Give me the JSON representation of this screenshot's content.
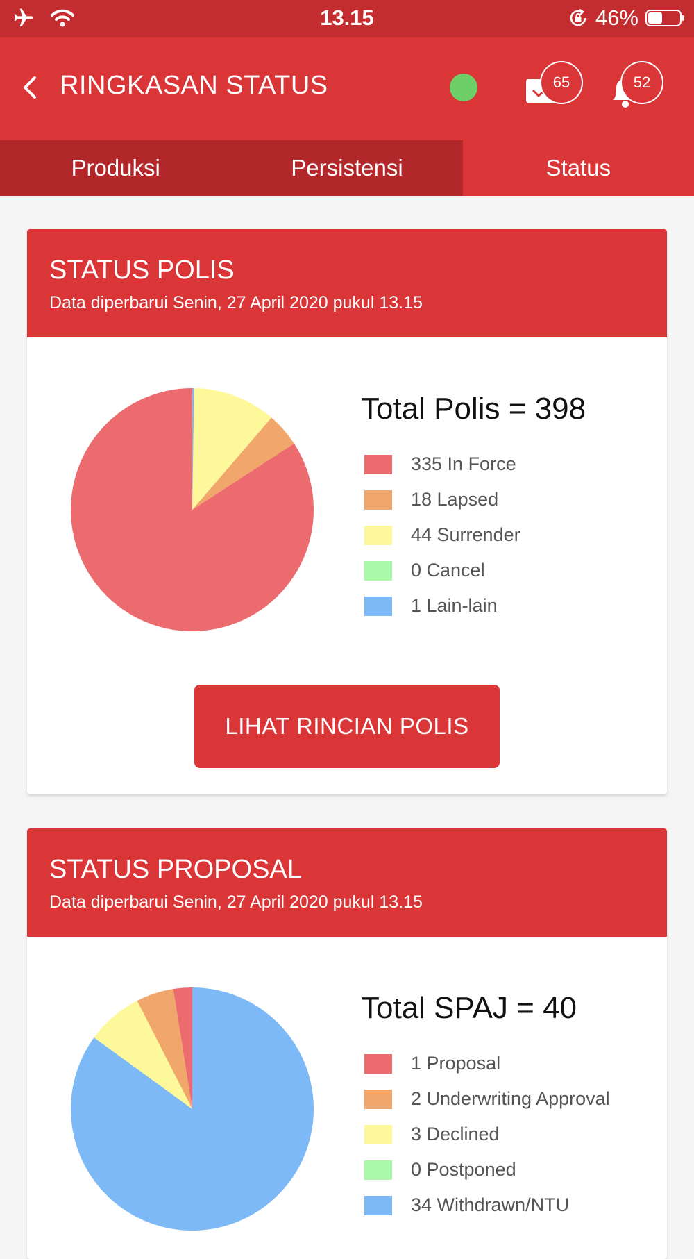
{
  "status_bar": {
    "time": "13.15",
    "battery_percent": "46%",
    "battery_level": 0.46,
    "icons": [
      "airplane-icon",
      "wifi-icon",
      "rotation-lock-icon",
      "battery-icon"
    ]
  },
  "header": {
    "title": "RINGKASAN STATUS",
    "online_color": "#6ecf68",
    "mail_badge": "65",
    "notification_badge": "52"
  },
  "tabs": [
    {
      "label": "Produksi",
      "active": false
    },
    {
      "label": "Persistensi",
      "active": false
    },
    {
      "label": "Status",
      "active": true
    }
  ],
  "colors": {
    "primary": "#da3638",
    "status_bar": "#c42d30",
    "tab_bar": "#b2272a"
  },
  "polis": {
    "title": "STATUS POLIS",
    "updated": "Data diperbarui Senin, 27 April 2020 pukul 13.15",
    "total_label": "Total Polis = 398",
    "button_label": "LIHAT RINCIAN POLIS",
    "legend": [
      {
        "label": "335 In Force",
        "value": 335,
        "color": "#ec6b6f"
      },
      {
        "label": "18 Lapsed",
        "value": 18,
        "color": "#f1a66b"
      },
      {
        "label": "44 Surrender",
        "value": 44,
        "color": "#fdf99b"
      },
      {
        "label": "0 Cancel",
        "value": 0,
        "color": "#aaf9a8"
      },
      {
        "label": "1 Lain-lain",
        "value": 1,
        "color": "#7db9f6"
      }
    ]
  },
  "proposal": {
    "title": "STATUS PROPOSAL",
    "updated": "Data diperbarui Senin, 27 April 2020 pukul 13.15",
    "total_label": "Total SPAJ = 40",
    "legend": [
      {
        "label": "1 Proposal",
        "value": 1,
        "color": "#ec6b6f"
      },
      {
        "label": "2 Underwriting Approval",
        "value": 2,
        "color": "#f1a66b"
      },
      {
        "label": "3 Declined",
        "value": 3,
        "color": "#fdf99b"
      },
      {
        "label": "0 Postponed",
        "value": 0,
        "color": "#aaf9a8"
      },
      {
        "label": "34 Withdrawn/NTU",
        "value": 34,
        "color": "#7db9f6"
      }
    ]
  }
}
